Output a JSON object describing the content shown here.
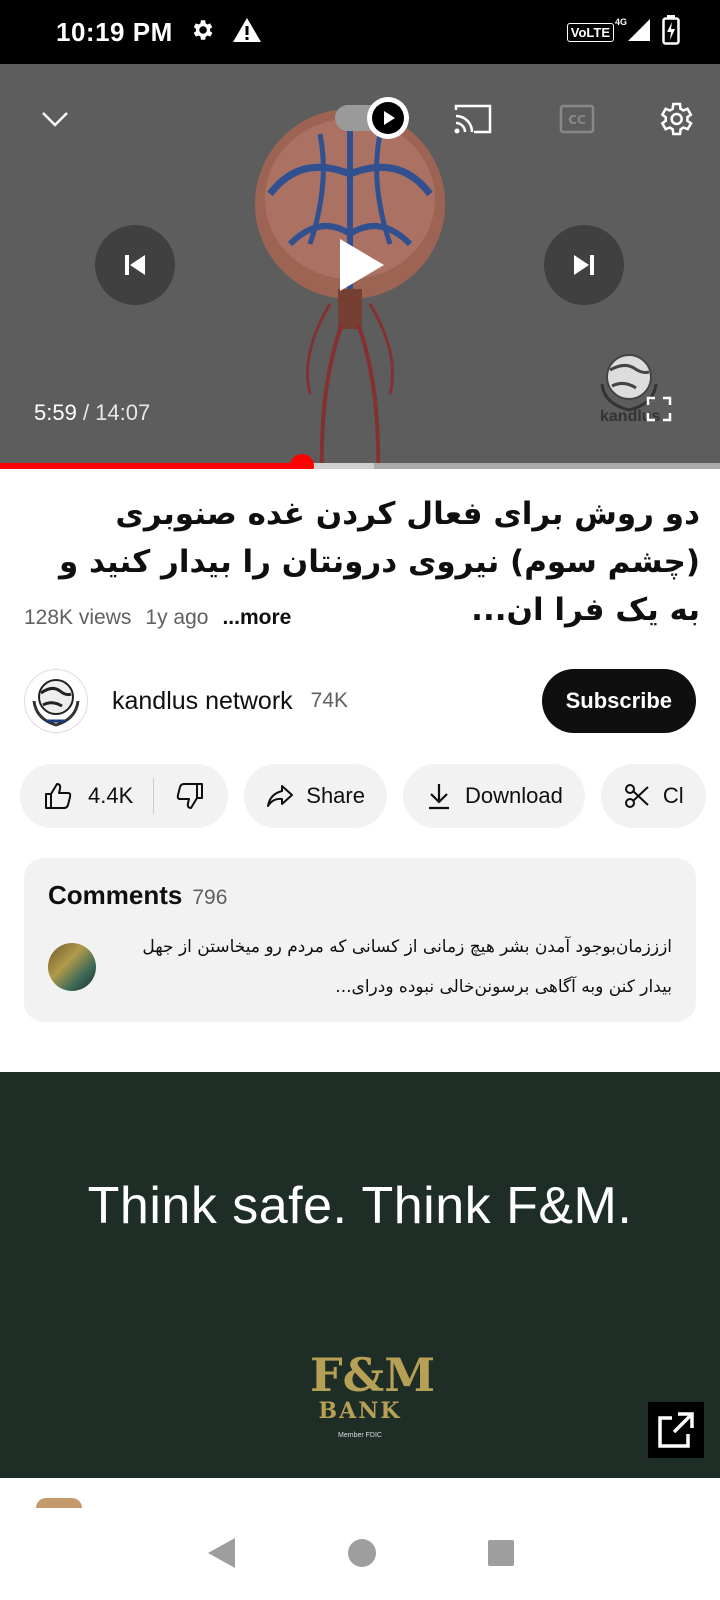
{
  "status_bar": {
    "time": "10:19 PM",
    "network_label": "VoLTE",
    "network_gen": "4G",
    "icons": [
      "gear-icon",
      "warning-icon",
      "signal-icon",
      "battery-charging-icon"
    ]
  },
  "player": {
    "current_time": "5:59",
    "separator": " / ",
    "duration": "14:07",
    "watermark_text": "kandlus",
    "progress_fraction": 0.42,
    "buffer_fraction": 0.52,
    "controls": [
      "chevron-down-icon",
      "autoplay-toggle",
      "cast-icon",
      "cc-icon",
      "gear-icon",
      "previous-icon",
      "play-icon",
      "next-icon",
      "fullscreen-icon"
    ]
  },
  "video": {
    "title": "دو روش برای فعال کردن غده صنوبری (چشم سوم)  نیروی درونتان را بیدار کنید و به یک فرا ان...",
    "views": "128K views",
    "age": "1y ago",
    "more_label": "...more"
  },
  "channel": {
    "name": "kandlus network",
    "subscribers": "74K",
    "subscribe_label": "Subscribe"
  },
  "actions": {
    "likes": "4.4K",
    "share_label": "Share",
    "download_label": "Download",
    "clip_label": "Cl"
  },
  "comments": {
    "title": "Comments",
    "count": "796",
    "top_comment": "ازززمان‌بوجود آمدن بشر هیچ زمانی از کسانی که مردم رو میخاستن از جهل بیدار کنن وبه آگاهی برسونن‌خالی نبوده ودرای..."
  },
  "ad": {
    "headline": "Think safe. Think F&M.",
    "logo_top": "F&M",
    "logo_bottom": "BANK",
    "fdic": "Member FDIC",
    "colors": {
      "background": "#1e2d25",
      "gold": "#b6a056"
    }
  },
  "nav": {
    "icons": [
      "back-icon",
      "home-icon",
      "recents-icon"
    ]
  }
}
